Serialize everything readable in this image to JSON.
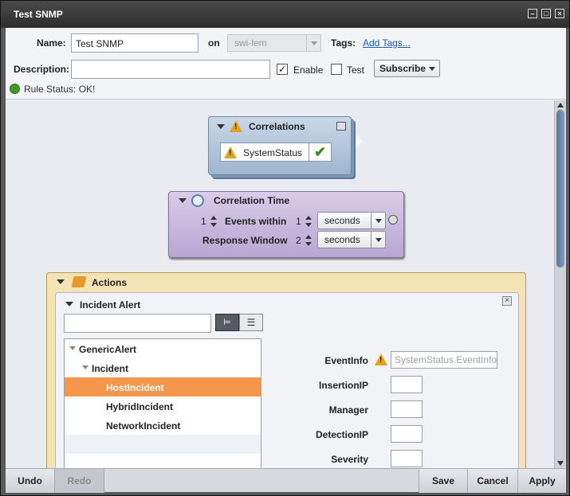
{
  "window": {
    "title": "Test SNMP"
  },
  "header": {
    "name_label": "Name:",
    "name_value": "Test SNMP",
    "on_label": "on",
    "on_value": "swi-lem",
    "tags_label": "Tags:",
    "add_tags": "Add Tags...",
    "description_label": "Description:",
    "description_value": "",
    "enable_label": "Enable",
    "enable_checked": true,
    "test_label": "Test",
    "test_checked": false,
    "subscribe_label": "Subscribe",
    "rule_status": "Rule Status: OK!"
  },
  "correlations": {
    "title": "Correlations",
    "item": "SystemStatus"
  },
  "correlation_time": {
    "title": "Correlation Time",
    "events_count": "1",
    "events_within_label": "Events within",
    "events_within_value": "1",
    "events_unit": "seconds",
    "response_window_label": "Response Window",
    "response_window_value": "2",
    "response_unit": "seconds"
  },
  "actions": {
    "title": "Actions",
    "incident_alert": {
      "title": "Incident Alert",
      "search_value": "",
      "tree": [
        {
          "label": "GenericAlert",
          "level": 0,
          "expanded": true
        },
        {
          "label": "Incident",
          "level": 1,
          "expanded": true
        },
        {
          "label": "HostIncident",
          "level": 2,
          "selected": true
        },
        {
          "label": "HybridIncident",
          "level": 2
        },
        {
          "label": "NetworkIncident",
          "level": 2
        }
      ],
      "fields": {
        "eventinfo_label": "EventInfo",
        "eventinfo_value": "SystemStatus.EventInfo",
        "insertionip_label": "InsertionIP",
        "manager_label": "Manager",
        "detectionip_label": "DetectionIP",
        "severity_label": "Severity"
      }
    }
  },
  "footer": {
    "undo": "Undo",
    "redo": "Redo",
    "save": "Save",
    "cancel": "Cancel",
    "apply": "Apply"
  },
  "colors": {
    "correlations_bg": "#b3c7dc",
    "correlation_time_bg": "#c8bbde",
    "actions_bg": "#f4e3b4",
    "selected_row": "#f4964b",
    "warning": "#e3a21a",
    "ok_check": "#3f8a1e"
  }
}
